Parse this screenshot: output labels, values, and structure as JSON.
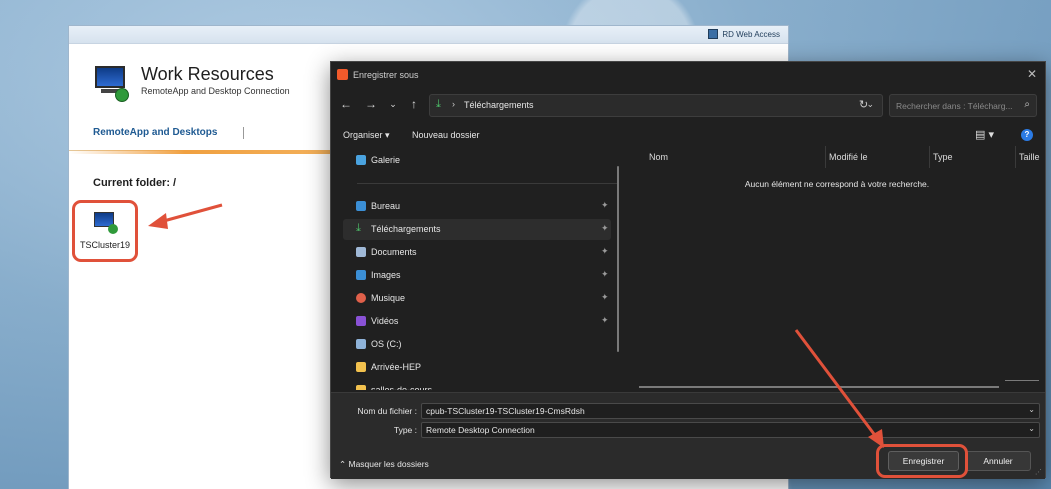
{
  "rdweb": {
    "brand": "RD Web Access",
    "title": "Work Resources",
    "subtitle": "RemoteApp and Desktop Connection",
    "nav": "RemoteApp and Desktops",
    "current_folder": "Current folder: /",
    "resource_label": "TSCluster19"
  },
  "dialog": {
    "title": "Enregistrer sous",
    "close_icon": "✕",
    "address": {
      "path": "Téléchargements",
      "breadcrumb_sep": "›"
    },
    "search_placeholder": "Rechercher dans : Télécharg...",
    "toolbar": {
      "organize": "Organiser ▾",
      "new_folder": "Nouveau dossier",
      "help": "?"
    },
    "nav_items": [
      {
        "label": "Galerie",
        "icon": "gallery-icon",
        "color": "#4aa3df",
        "pinned": false
      },
      {
        "label": "Bureau",
        "icon": "desktop-icon",
        "color": "#3b8fd6",
        "pinned": true
      },
      {
        "label": "Téléchargements",
        "icon": "download-icon",
        "color": "#4ec46b",
        "pinned": true
      },
      {
        "label": "Documents",
        "icon": "documents-icon",
        "color": "#9fb8d6",
        "pinned": true
      },
      {
        "label": "Images",
        "icon": "images-icon",
        "color": "#3b8fd6",
        "pinned": true
      },
      {
        "label": "Musique",
        "icon": "music-icon",
        "color": "#e0604a",
        "pinned": true
      },
      {
        "label": "Vidéos",
        "icon": "videos-icon",
        "color": "#8a52d6",
        "pinned": true
      },
      {
        "label": "OS (C:)",
        "icon": "drive-icon",
        "color": "#8fb3d9",
        "pinned": false
      },
      {
        "label": "Arrivée-HEP",
        "icon": "folder-icon",
        "color": "#f2c14e",
        "pinned": false
      },
      {
        "label": "salles-de-cours",
        "icon": "folder-icon",
        "color": "#f2c14e",
        "pinned": false
      }
    ],
    "columns": [
      "Nom",
      "Modifié le",
      "Type",
      "Taille"
    ],
    "empty_message": "Aucun élément ne correspond à votre recherche.",
    "filename_label": "Nom du fichier :",
    "filename_value": "cpub-TSCluster19-TSCluster19-CmsRdsh",
    "type_label": "Type :",
    "type_value": "Remote Desktop Connection",
    "hide_folders": "Masquer les dossiers",
    "save_button": "Enregistrer",
    "cancel_button": "Annuler"
  },
  "colors": {
    "annotation": "#e0513a",
    "accent": "#2b7be5"
  }
}
